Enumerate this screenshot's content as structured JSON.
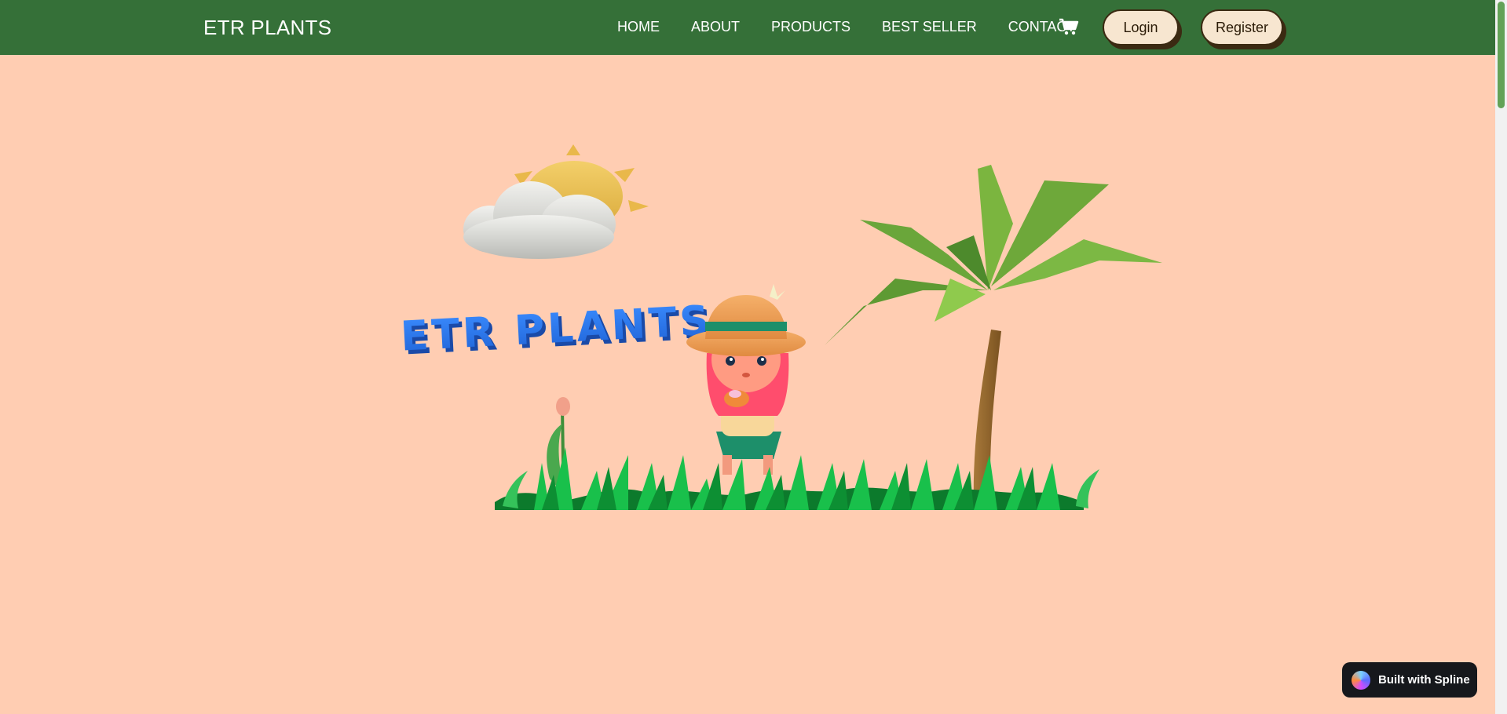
{
  "brand": "ETR PLANTS",
  "nav": [
    "HOME",
    "ABOUT",
    "PRODUCTS",
    "BEST SELLER",
    "CONTACT"
  ],
  "buttons": {
    "login": "Login",
    "register": "Register"
  },
  "hero": {
    "title": "ETR PLANTS"
  },
  "badge": {
    "label": "Built with Spline"
  },
  "colors": {
    "navbar": "#357038",
    "background": "#ffcdb2",
    "title": "#2f7ef0",
    "button": "#f7e6d0"
  }
}
